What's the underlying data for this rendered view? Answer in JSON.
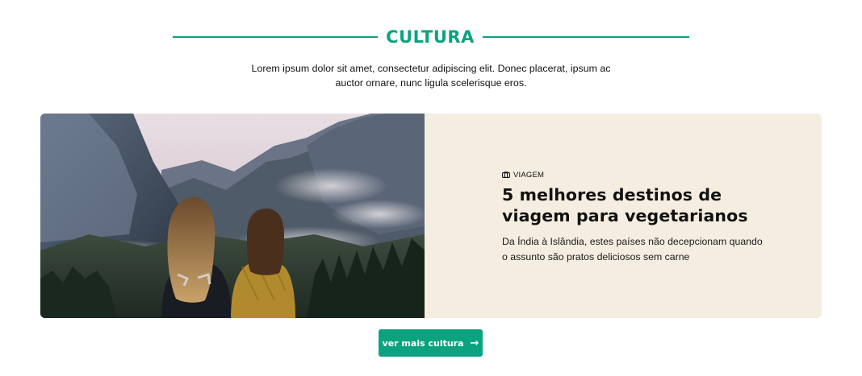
{
  "section": {
    "title": "CULTURA",
    "intro": "Lorem ipsum dolor sit amet, consectetur adipiscing elit. Donec placerat, ipsum ac auctor ornare, nunc ligula scelerisque eros."
  },
  "featured": {
    "image_alt": "Duas mulheres de costas olhando para um vale com montanhas",
    "category": {
      "icon": "travel-icon",
      "label": "VIAGEM"
    },
    "title": "5 melhores destinos de viagem para vegetarianos",
    "description": "Da Índia à Islândia, estes países não decepcionam quando o assunto são pratos deliciosos sem carne"
  },
  "more_button": {
    "label": "ver mais cultura",
    "icon": "arrow-right-icon"
  },
  "colors": {
    "accent": "#0aa37f",
    "card_background": "#f5ede0"
  }
}
